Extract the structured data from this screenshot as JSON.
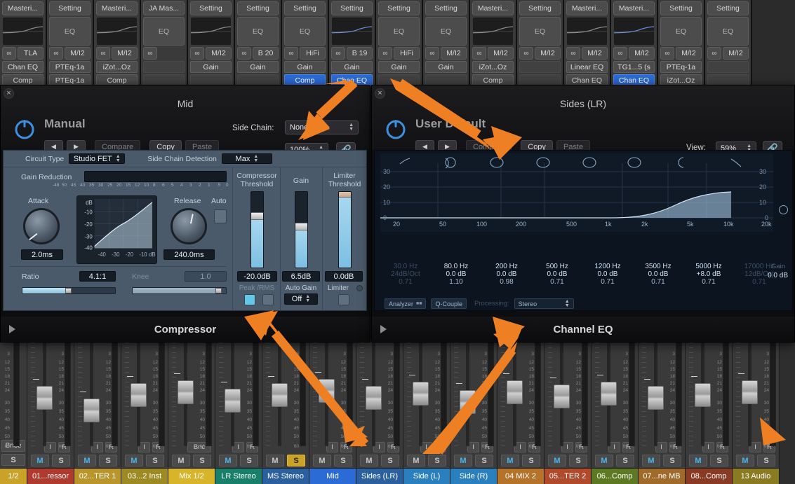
{
  "strips": [
    {
      "setting": "Masteri...",
      "eq": "curve",
      "io_label": "TLA",
      "inserts": [
        "Chan EQ",
        "Comp"
      ]
    },
    {
      "setting": "Setting",
      "eq": "EQ",
      "io_label": "M/I2",
      "inserts": [
        "PTEq-1a",
        "PTEq-1a"
      ]
    },
    {
      "setting": "Masteri...",
      "eq": "curve",
      "io_label": "M/I2",
      "inserts": [
        "iZot...Oz",
        "Comp"
      ]
    },
    {
      "setting": "JA Mas...",
      "eq": "EQ",
      "io_label": "",
      "inserts": [
        "",
        ""
      ]
    },
    {
      "setting": "Setting",
      "eq": "curve",
      "io_label": "M/I2",
      "inserts": [
        "Gain",
        ""
      ]
    },
    {
      "setting": "Setting",
      "eq": "EQ",
      "io_label": "B 20",
      "inserts": [
        "Gain",
        ""
      ]
    },
    {
      "setting": "Setting",
      "eq": "EQ",
      "io_label": "HiFi",
      "inserts": [
        "Gain",
        "Comp"
      ],
      "selected": 1
    },
    {
      "setting": "Setting",
      "eq": "curve",
      "io_label": "B 19",
      "inserts": [
        "Gain",
        "Chan EQ"
      ],
      "selected": 1
    },
    {
      "setting": "Setting",
      "eq": "EQ",
      "io_label": "HiFi",
      "inserts": [
        "Gain",
        ""
      ]
    },
    {
      "setting": "Setting",
      "eq": "EQ",
      "io_label": "M/I2",
      "inserts": [
        "Gain",
        ""
      ]
    },
    {
      "setting": "Masteri...",
      "eq": "curve",
      "io_label": "M/I2",
      "inserts": [
        "iZot...Oz",
        "Comp"
      ]
    },
    {
      "setting": "Setting",
      "eq": "EQ",
      "io_label": "M/I2",
      "inserts": [
        "",
        ""
      ]
    },
    {
      "setting": "Masteri...",
      "eq": "curve",
      "io_label": "M/I2",
      "inserts": [
        "Linear EQ",
        "Chan EQ"
      ]
    },
    {
      "setting": "Masteri...",
      "eq": "curve",
      "io_label": "M/I2",
      "inserts": [
        "TG1...5 (s",
        "Chan EQ"
      ],
      "selected": 1
    },
    {
      "setting": "Setting",
      "eq": "EQ",
      "io_label": "M/I2",
      "inserts": [
        "PTEq-1a",
        "iZot...Oz"
      ]
    },
    {
      "setting": "Setting",
      "eq": "EQ",
      "io_label": "M/I2",
      "inserts": [
        "",
        ""
      ]
    }
  ],
  "compressor": {
    "window_title": "Mid",
    "close_label": "×",
    "preset_name": "Manual",
    "compare_label": "Compare",
    "copy_label": "Copy",
    "paste_label": "Paste",
    "sidechain_label": "Side Chain:",
    "sidechain_value": "None",
    "view_value": "100%",
    "circuit_type_label": "Circuit Type",
    "circuit_type_value": "Studio FET",
    "sidechain_detection_label": "Side Chain Detection",
    "sidechain_detection_value": "Max",
    "gain_reduction_label": "Gain Reduction",
    "gr_scale": [
      "-48",
      "50",
      "45",
      "40",
      "35",
      "30",
      "25",
      "20",
      "15",
      "12",
      "10",
      "8",
      "6",
      "5",
      "4",
      "3",
      "2",
      "1",
      ".5",
      "0"
    ],
    "attack_label": "Attack",
    "attack_value": "2.0ms",
    "release_label": "Release",
    "release_value": "240.0ms",
    "auto_label": "Auto",
    "ratio_label": "Ratio",
    "ratio_value": "4.1:1",
    "knee_label": "Knee",
    "knee_value": "1.0",
    "graph_y_unit": "dB",
    "graph_y_ticks": [
      "-10",
      "-20",
      "-30",
      "-40"
    ],
    "graph_x_ticks": [
      "-40",
      "-30",
      "-20",
      "-10",
      "dB"
    ],
    "comp_threshold_label": "Compressor\nThreshold",
    "comp_threshold_value": "-20.0dB",
    "gain_label": "Gain",
    "gain_value": "6.5dB",
    "limiter_threshold_label": "Limiter\nThreshold",
    "limiter_threshold_value": "0.0dB",
    "peak_rms_label": "Peak /RMS",
    "auto_gain_label": "Auto Gain",
    "auto_gain_value": "Off",
    "limiter_label": "Limiter",
    "footer_title": "Compressor"
  },
  "channel_eq": {
    "window_title": "Sides (LR)",
    "close_label": "×",
    "preset_name": "User Default",
    "compare_label": "Compare",
    "copy_label": "Copy",
    "paste_label": "Paste",
    "view_label": "View:",
    "view_value": "59%",
    "freq_ticks": [
      "20",
      "50",
      "100",
      "200",
      "500",
      "1k",
      "2k",
      "5k",
      "10k",
      "20k"
    ],
    "db_ticks_left": [
      "30",
      "20",
      "10",
      "0"
    ],
    "db_ticks_right": [
      "30",
      "20",
      "10",
      "0"
    ],
    "bands": [
      {
        "freq": "30.0 Hz",
        "gain": "24dB/Oct",
        "q": "0.71",
        "dim": true
      },
      {
        "freq": "80.0 Hz",
        "gain": "0.0 dB",
        "q": "1.10",
        "dim": false
      },
      {
        "freq": "200 Hz",
        "gain": "0.0 dB",
        "q": "0.98",
        "dim": false
      },
      {
        "freq": "500 Hz",
        "gain": "0.0 dB",
        "q": "0.71",
        "dim": false
      },
      {
        "freq": "1200 Hz",
        "gain": "0.0 dB",
        "q": "0.71",
        "dim": false
      },
      {
        "freq": "3500 Hz",
        "gain": "0.0 dB",
        "q": "0.71",
        "dim": false
      },
      {
        "freq": "5000 Hz",
        "gain": "+8.0 dB",
        "q": "0.71",
        "dim": false
      },
      {
        "freq": "17000 Hz",
        "gain": "12dB/Oct",
        "q": "0.71",
        "dim": true
      }
    ],
    "master_gain_label": "Gain",
    "master_gain_value": "0.0 dB",
    "analyzer_label": "Analyzer",
    "qcouple_label": "Q-Couple",
    "processing_label": "Processing:",
    "processing_value": "Stereo",
    "footer_title": "Channel EQ"
  },
  "mixer": {
    "fader_scale": [
      "3",
      "12",
      "15",
      "18",
      "21",
      "24",
      "30",
      "35",
      "40",
      "45",
      "50",
      "60"
    ],
    "left_column": {
      "bounce_label": "Bnce",
      "solo_label": "S",
      "out_label": "1/2"
    },
    "channels": [
      {
        "name": "01...ressor",
        "color": "#b03a2e",
        "io": [
          "I",
          "R"
        ],
        "m": true,
        "s": false
      },
      {
        "name": "02...TER 1",
        "color": "#b9952b",
        "io": [
          "I",
          "R"
        ],
        "m": true,
        "s": false
      },
      {
        "name": "03...2 Inst",
        "color": "#9d8a22",
        "io": [
          "I",
          "R"
        ],
        "m": true,
        "s": false
      },
      {
        "name": "Mix 1/2",
        "color": "#d8b42b",
        "io": [
          "Bnc"
        ],
        "m": false,
        "s": false
      },
      {
        "name": "LR Stereo",
        "color": "#18806a",
        "io": [
          "I",
          "R"
        ],
        "m": true,
        "s": false
      },
      {
        "name": "MS Stereo",
        "color": "#2b5f9e",
        "io": [],
        "m": false,
        "s": true
      },
      {
        "name": "Mid",
        "color": "#2b6bd6",
        "io": [
          "I",
          "R"
        ],
        "m": false,
        "s": false
      },
      {
        "name": "Sides (LR)",
        "color": "#2b5f9e",
        "io": [
          "I",
          "R"
        ],
        "m": false,
        "s": false
      },
      {
        "name": "Side (L)",
        "color": "#2a7fbf",
        "io": [
          "I",
          "R"
        ],
        "m": false,
        "s": false
      },
      {
        "name": "Side (R)",
        "color": "#2a7fbf",
        "io": [
          "I",
          "R"
        ],
        "m": true,
        "s": false
      },
      {
        "name": "04 MIX 2",
        "color": "#b5732a",
        "io": [
          "I",
          "R"
        ],
        "m": true,
        "s": false
      },
      {
        "name": "05...TER 2",
        "color": "#b04a2a",
        "io": [
          "I",
          "R"
        ],
        "m": true,
        "s": false
      },
      {
        "name": "06...Comp",
        "color": "#5d7a22",
        "io": [
          "I",
          "R"
        ],
        "m": true,
        "s": false
      },
      {
        "name": "07...ne MB",
        "color": "#a06a2a",
        "io": [
          "I",
          "R"
        ],
        "m": true,
        "s": false
      },
      {
        "name": "08...Comp",
        "color": "#8a3a22",
        "io": [
          "I",
          "R"
        ],
        "m": true,
        "s": false
      },
      {
        "name": "13 Audio",
        "color": "#8a7a22",
        "io": [
          "I",
          "R"
        ],
        "m": true,
        "s": false
      }
    ]
  },
  "colors": {
    "accent_blue": "#2b6bd6",
    "arrow_orange": "#ef7f23",
    "eq_curve": "#9fc2dd",
    "comp_curve": "#bcd6e6"
  }
}
